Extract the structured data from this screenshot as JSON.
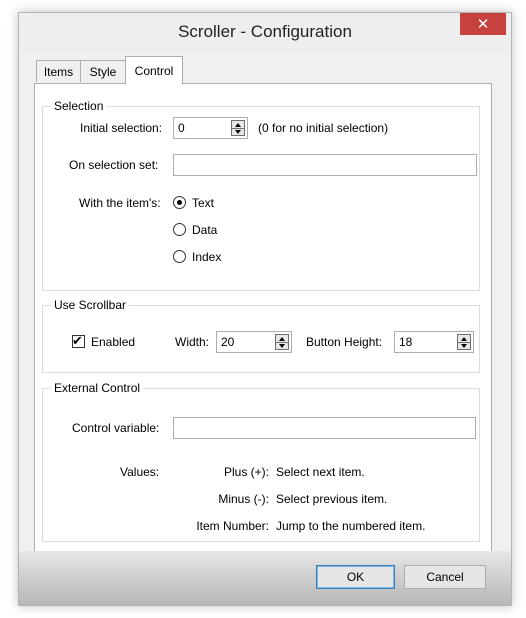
{
  "window": {
    "title": "Scroller - Configuration",
    "close_glyph": "✕"
  },
  "tabs": [
    {
      "label": "Items",
      "active": false
    },
    {
      "label": "Style",
      "active": false
    },
    {
      "label": "Control",
      "active": true
    }
  ],
  "selection": {
    "group_label": "Selection",
    "initial_label": "Initial selection:",
    "initial_value": "0",
    "initial_hint": "(0 for no initial selection)",
    "on_set_label": "On selection set:",
    "on_set_value": "",
    "with_label": "With the item's:",
    "options": [
      {
        "label": "Text",
        "checked": true
      },
      {
        "label": "Data",
        "checked": false
      },
      {
        "label": "Index",
        "checked": false
      }
    ]
  },
  "scrollbar": {
    "group_label": "Use Scrollbar",
    "enabled_label": "Enabled",
    "enabled_checked": true,
    "width_label": "Width:",
    "width_value": "20",
    "button_height_label": "Button Height:",
    "button_height_value": "18"
  },
  "external": {
    "group_label": "External Control",
    "variable_label": "Control variable:",
    "variable_value": "",
    "values_label": "Values:",
    "rows": [
      {
        "key": "Plus (+):",
        "desc": "Select next item."
      },
      {
        "key": "Minus (-):",
        "desc": "Select previous item."
      },
      {
        "key": "Item Number:",
        "desc": "Jump to the numbered item."
      }
    ]
  },
  "buttons": {
    "ok": "OK",
    "cancel": "Cancel"
  },
  "colors": {
    "close_button": "#c7413f",
    "default_button_border": "#3c7fb1"
  }
}
